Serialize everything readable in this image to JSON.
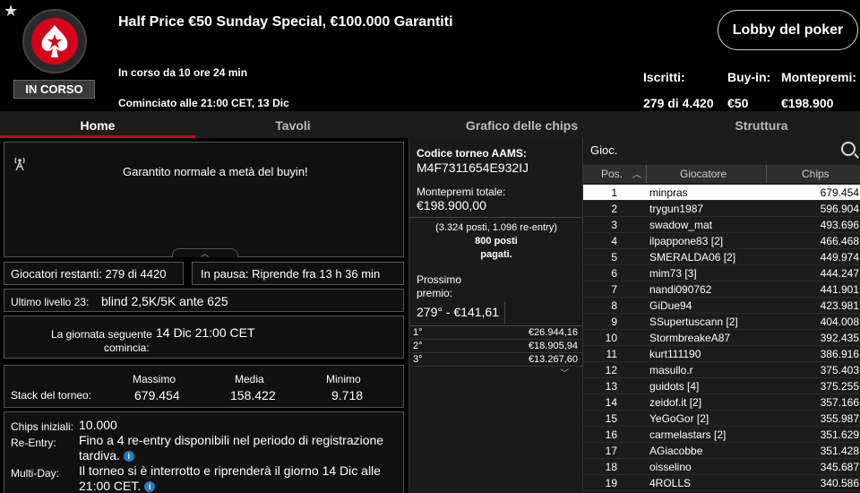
{
  "header": {
    "status": "IN CORSO",
    "title": "Half Price €50 Sunday Special, €100.000 Garantiti",
    "running": "In corso da 10 ore 24 min",
    "started": "Cominciato alle 21:00 CET, 13 Dic",
    "lobby_button": "Lobby del poker",
    "stats": {
      "entrants_label": "Iscritti:",
      "entrants_value": "279 di 4.420",
      "buyin_label": "Buy-in:",
      "buyin_value": "€50",
      "prize_label": "Montepremi:",
      "prize_value": "€198.900"
    }
  },
  "tabs": [
    "Home",
    "Tavoli",
    "Grafico delle chips",
    "Struttura"
  ],
  "home": {
    "banner_text": "Garantito normale a metà del buyin!",
    "players_left": "Giocatori restanti: 279 di 4420",
    "paused": "In pausa: Riprende fra 13 h 36 min",
    "last_level_label": "Ultimo livello 23:",
    "last_level_value": "blind 2,5K/5K ante 625",
    "next_day_label_1": "La giornata seguente",
    "next_day_label_2": "comincia:",
    "next_day_value": "14 Dic 21:00 CET",
    "stack": {
      "label": "Stack del torneo:",
      "max_label": "Massimo",
      "max_value": "679.454",
      "avg_label": "Media",
      "avg_value": "158.422",
      "min_label": "Minimo",
      "min_value": "9.718"
    },
    "starting_chips_label": "Chips iniziali:",
    "starting_chips_value": "10.000",
    "reentry_label": "Re-Entry:",
    "reentry_value": "Fino a 4 re-entry disponibili nel periodo di registrazione tardiva.",
    "multiday_label": "Multi-Day:",
    "multiday_value": "Il torneo si è interrotto e riprenderà il giorno 14 Dic alle 21:00 CET."
  },
  "middle": {
    "code_label": "Codice torneo AAMS:",
    "code_value": "M4F7311654E932IJ",
    "total_prize_label": "Montepremi totale:",
    "total_prize_value": "€198.900,00",
    "seats_line": "(3.324 posti, 1.096 re-entry)",
    "paid_line_1": "800 posti",
    "paid_line_2": "pagati.",
    "next_prize_label_1": "Prossimo",
    "next_prize_label_2": "premio:",
    "next_prize_value": "279° - €141,61",
    "prizes": [
      {
        "pos": "1°",
        "amt": "€26.944,16"
      },
      {
        "pos": "2°",
        "amt": "€18.905,94"
      },
      {
        "pos": "3°",
        "amt": "€13.267,60"
      }
    ]
  },
  "players": {
    "search_label": "Gioc.",
    "col_pos": "Pos.",
    "col_player": "Giocatore",
    "col_chips": "Chips",
    "rows": [
      {
        "pos": "1",
        "name": "minpras",
        "chips": "679.454"
      },
      {
        "pos": "2",
        "name": "trygun1987",
        "chips": "596.904"
      },
      {
        "pos": "3",
        "name": "swadow_mat",
        "chips": "493.696"
      },
      {
        "pos": "4",
        "name": "ilpappone83 [2]",
        "chips": "466.468"
      },
      {
        "pos": "5",
        "name": "SMERALDA06 [2]",
        "chips": "449.974"
      },
      {
        "pos": "6",
        "name": "mim73 [3]",
        "chips": "444.247"
      },
      {
        "pos": "7",
        "name": "nandi090762",
        "chips": "441.901"
      },
      {
        "pos": "8",
        "name": "GiDue94",
        "chips": "423.981"
      },
      {
        "pos": "9",
        "name": "SSupertuscann [2]",
        "chips": "404.008"
      },
      {
        "pos": "10",
        "name": "StormbreakeA87",
        "chips": "392.435"
      },
      {
        "pos": "11",
        "name": "kurt111190",
        "chips": "386.916"
      },
      {
        "pos": "12",
        "name": "masullo.r",
        "chips": "375.403"
      },
      {
        "pos": "13",
        "name": "guidots [4]",
        "chips": "375.255"
      },
      {
        "pos": "14",
        "name": "zeidof.it [2]",
        "chips": "357.166"
      },
      {
        "pos": "15",
        "name": "YeGoGor [2]",
        "chips": "355.987"
      },
      {
        "pos": "16",
        "name": "carmelastars [2]",
        "chips": "351.629"
      },
      {
        "pos": "17",
        "name": "AGiacobbe",
        "chips": "351.428"
      },
      {
        "pos": "18",
        "name": "oisselino",
        "chips": "345.687"
      },
      {
        "pos": "19",
        "name": "4ROLLS",
        "chips": "340.586"
      }
    ]
  }
}
